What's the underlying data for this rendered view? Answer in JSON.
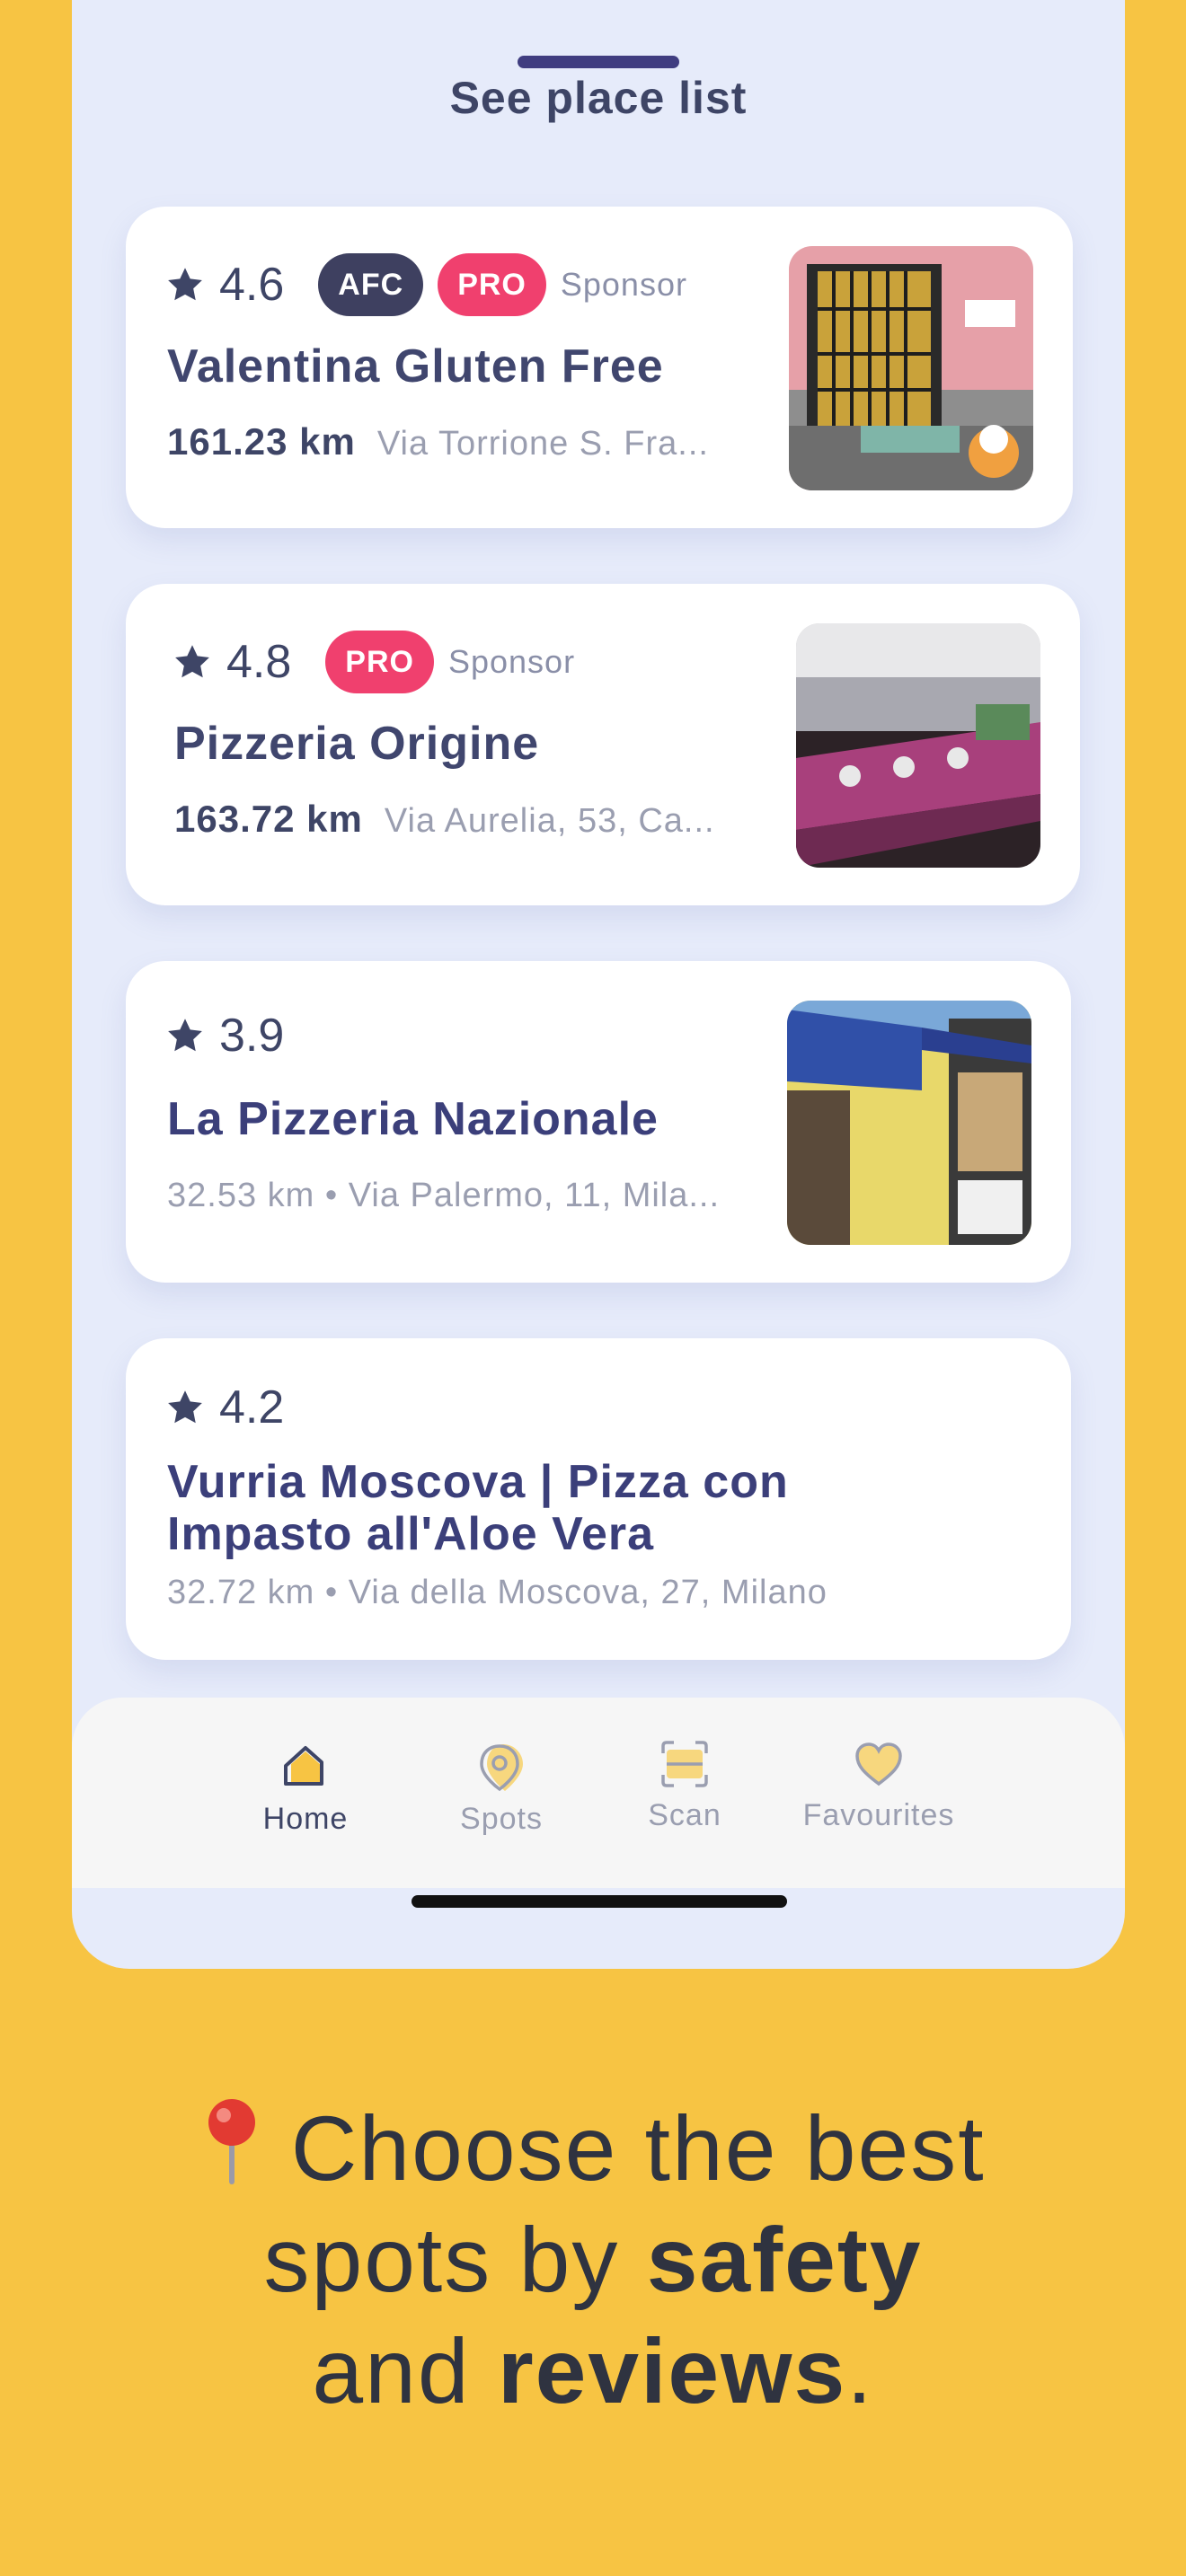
{
  "sheet": {
    "title": "See place list"
  },
  "places": [
    {
      "rating": "4.6",
      "badges": [
        "AFC",
        "PRO"
      ],
      "sponsor": "Sponsor",
      "name": "Valentina Gluten Free",
      "distance": "161.23 km",
      "address": "Via Torrione S. Fra..."
    },
    {
      "rating": "4.8",
      "badges": [
        "PRO"
      ],
      "sponsor": "Sponsor",
      "name": "Pizzeria Origine",
      "distance": "163.72 km",
      "address": "Via Aurelia, 53, Ca..."
    },
    {
      "rating": "3.9",
      "name": "La Pizzeria Nazionale",
      "subtitle": "32.53 km • Via Palermo, 11, Mila..."
    },
    {
      "rating": "4.2",
      "name_line1": "Vurria Moscova | Pizza con",
      "name_line2": "Impasto all'Aloe Vera",
      "subtitle": "32.72 km • Via della Moscova, 27, Milano"
    }
  ],
  "nav": {
    "items": [
      {
        "label": "Home",
        "icon": "home-icon",
        "active": true
      },
      {
        "label": "Spots",
        "icon": "location-pin-icon",
        "active": false
      },
      {
        "label": "Scan",
        "icon": "scan-icon",
        "active": false
      },
      {
        "label": "Favourites",
        "icon": "heart-icon",
        "active": false
      }
    ]
  },
  "caption": {
    "line1_text": "Choose the best",
    "line2_prefix": "spots by",
    "line2_bold": "safety",
    "line3_prefix": "and",
    "line3_bold": "reviews",
    "line3_suffix": "."
  },
  "colors": {
    "background": "#F7C443",
    "sheet": "#E6EBFA",
    "accent_pro": "#F0406E",
    "accent_afc": "#3E4060",
    "text_primary": "#40466E"
  }
}
